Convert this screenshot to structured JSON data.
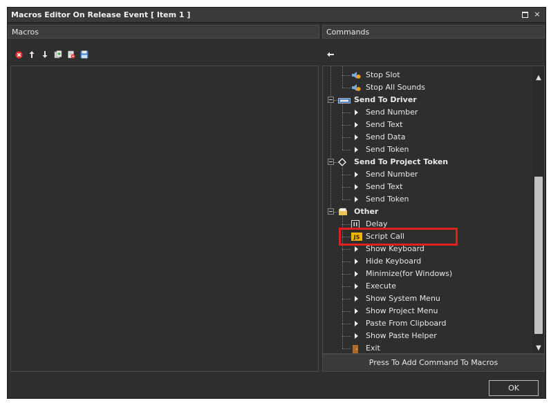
{
  "window": {
    "title": "Macros Editor On Release Event [ Item 1 ]",
    "maximize_glyph": "",
    "close_glyph": "×"
  },
  "macros": {
    "header": "Macros",
    "toolbar": [
      {
        "name": "delete-icon",
        "color": "#e03030"
      },
      {
        "name": "arrow-up-icon",
        "color": "#e8e8e8"
      },
      {
        "name": "arrow-down-icon",
        "color": "#e8e8e8"
      },
      {
        "name": "copy-icon",
        "color": "#6fbf4a"
      },
      {
        "name": "remove-document-icon",
        "color": "#e05050"
      },
      {
        "name": "save-icon",
        "color": "#5aa0e0"
      }
    ]
  },
  "commands": {
    "header": "Commands",
    "back_icon": "arrow-left-icon",
    "items": [
      {
        "label": "Stop Slot",
        "level": 1,
        "icon": "speaker-icon"
      },
      {
        "label": "Stop All Sounds",
        "level": 1,
        "icon": "speaker-icon"
      },
      {
        "label": "Send To Driver",
        "level": 0,
        "icon": "driver-icon",
        "group": true
      },
      {
        "label": "Send Number",
        "level": 1,
        "icon": "triangle-icon"
      },
      {
        "label": "Send Text",
        "level": 1,
        "icon": "triangle-icon"
      },
      {
        "label": "Send Data",
        "level": 1,
        "icon": "triangle-icon"
      },
      {
        "label": "Send Token",
        "level": 1,
        "icon": "triangle-icon"
      },
      {
        "label": "Send To Project Token",
        "level": 0,
        "icon": "diamond-icon",
        "group": true
      },
      {
        "label": "Send Number",
        "level": 1,
        "icon": "triangle-icon"
      },
      {
        "label": "Send Text",
        "level": 1,
        "icon": "triangle-icon"
      },
      {
        "label": "Send Token",
        "level": 1,
        "icon": "triangle-icon"
      },
      {
        "label": "Other",
        "level": 0,
        "icon": "folder-icon",
        "group": true
      },
      {
        "label": "Delay",
        "level": 1,
        "icon": "pause-icon"
      },
      {
        "label": "Script Call",
        "level": 1,
        "icon": "js-icon",
        "highlighted": true
      },
      {
        "label": "Show Keyboard",
        "level": 1,
        "icon": "triangle-icon"
      },
      {
        "label": "Hide Keyboard",
        "level": 1,
        "icon": "triangle-icon"
      },
      {
        "label": "Minimize(for Windows)",
        "level": 1,
        "icon": "triangle-icon"
      },
      {
        "label": "Execute",
        "level": 1,
        "icon": "triangle-icon"
      },
      {
        "label": "Show System Menu",
        "level": 1,
        "icon": "triangle-icon"
      },
      {
        "label": "Show Project Menu",
        "level": 1,
        "icon": "triangle-icon"
      },
      {
        "label": "Paste From Clipboard",
        "level": 1,
        "icon": "triangle-icon"
      },
      {
        "label": "Show Paste Helper",
        "level": 1,
        "icon": "triangle-icon"
      },
      {
        "label": "Exit",
        "level": 1,
        "icon": "door-icon"
      }
    ],
    "add_button": "Press To Add Command To Macros",
    "highlight_color": "#e0201e"
  },
  "footer": {
    "ok_label": "OK"
  }
}
